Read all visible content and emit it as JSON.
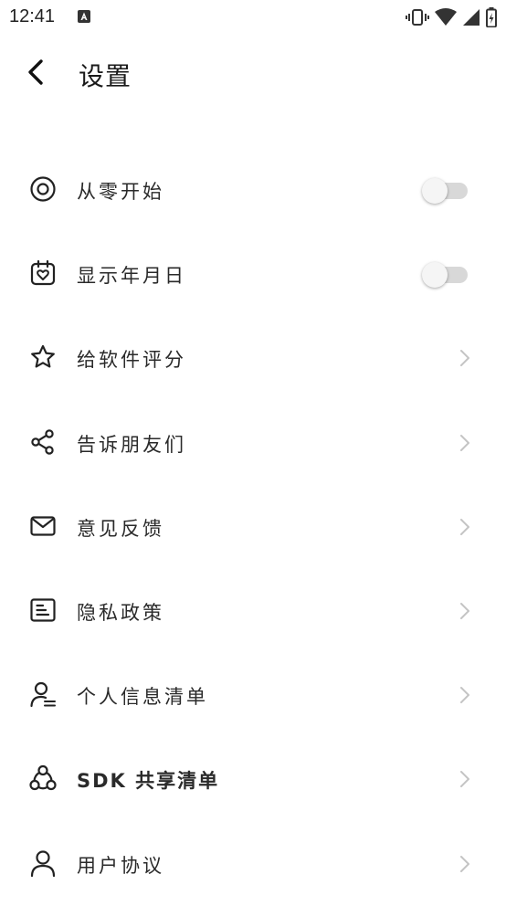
{
  "status_bar": {
    "time": "12:41"
  },
  "header": {
    "title": "设置"
  },
  "settings": [
    {
      "label": "从零开始",
      "icon": "target-icon",
      "control": "toggle",
      "enabled": false
    },
    {
      "label": "显示年月日",
      "icon": "calendar-heart-icon",
      "control": "toggle",
      "enabled": false
    },
    {
      "label": "给软件评分",
      "icon": "star-icon",
      "control": "chevron"
    },
    {
      "label": "告诉朋友们",
      "icon": "share-icon",
      "control": "chevron"
    },
    {
      "label": "意见反馈",
      "icon": "mail-icon",
      "control": "chevron"
    },
    {
      "label": "隐私政策",
      "icon": "document-icon",
      "control": "chevron"
    },
    {
      "label": "个人信息清单",
      "icon": "user-list-icon",
      "control": "chevron"
    },
    {
      "label": "SDK 共享清单",
      "icon": "triangle-nodes-icon",
      "control": "chevron"
    },
    {
      "label": "用户协议",
      "icon": "user-icon",
      "control": "chevron"
    }
  ]
}
